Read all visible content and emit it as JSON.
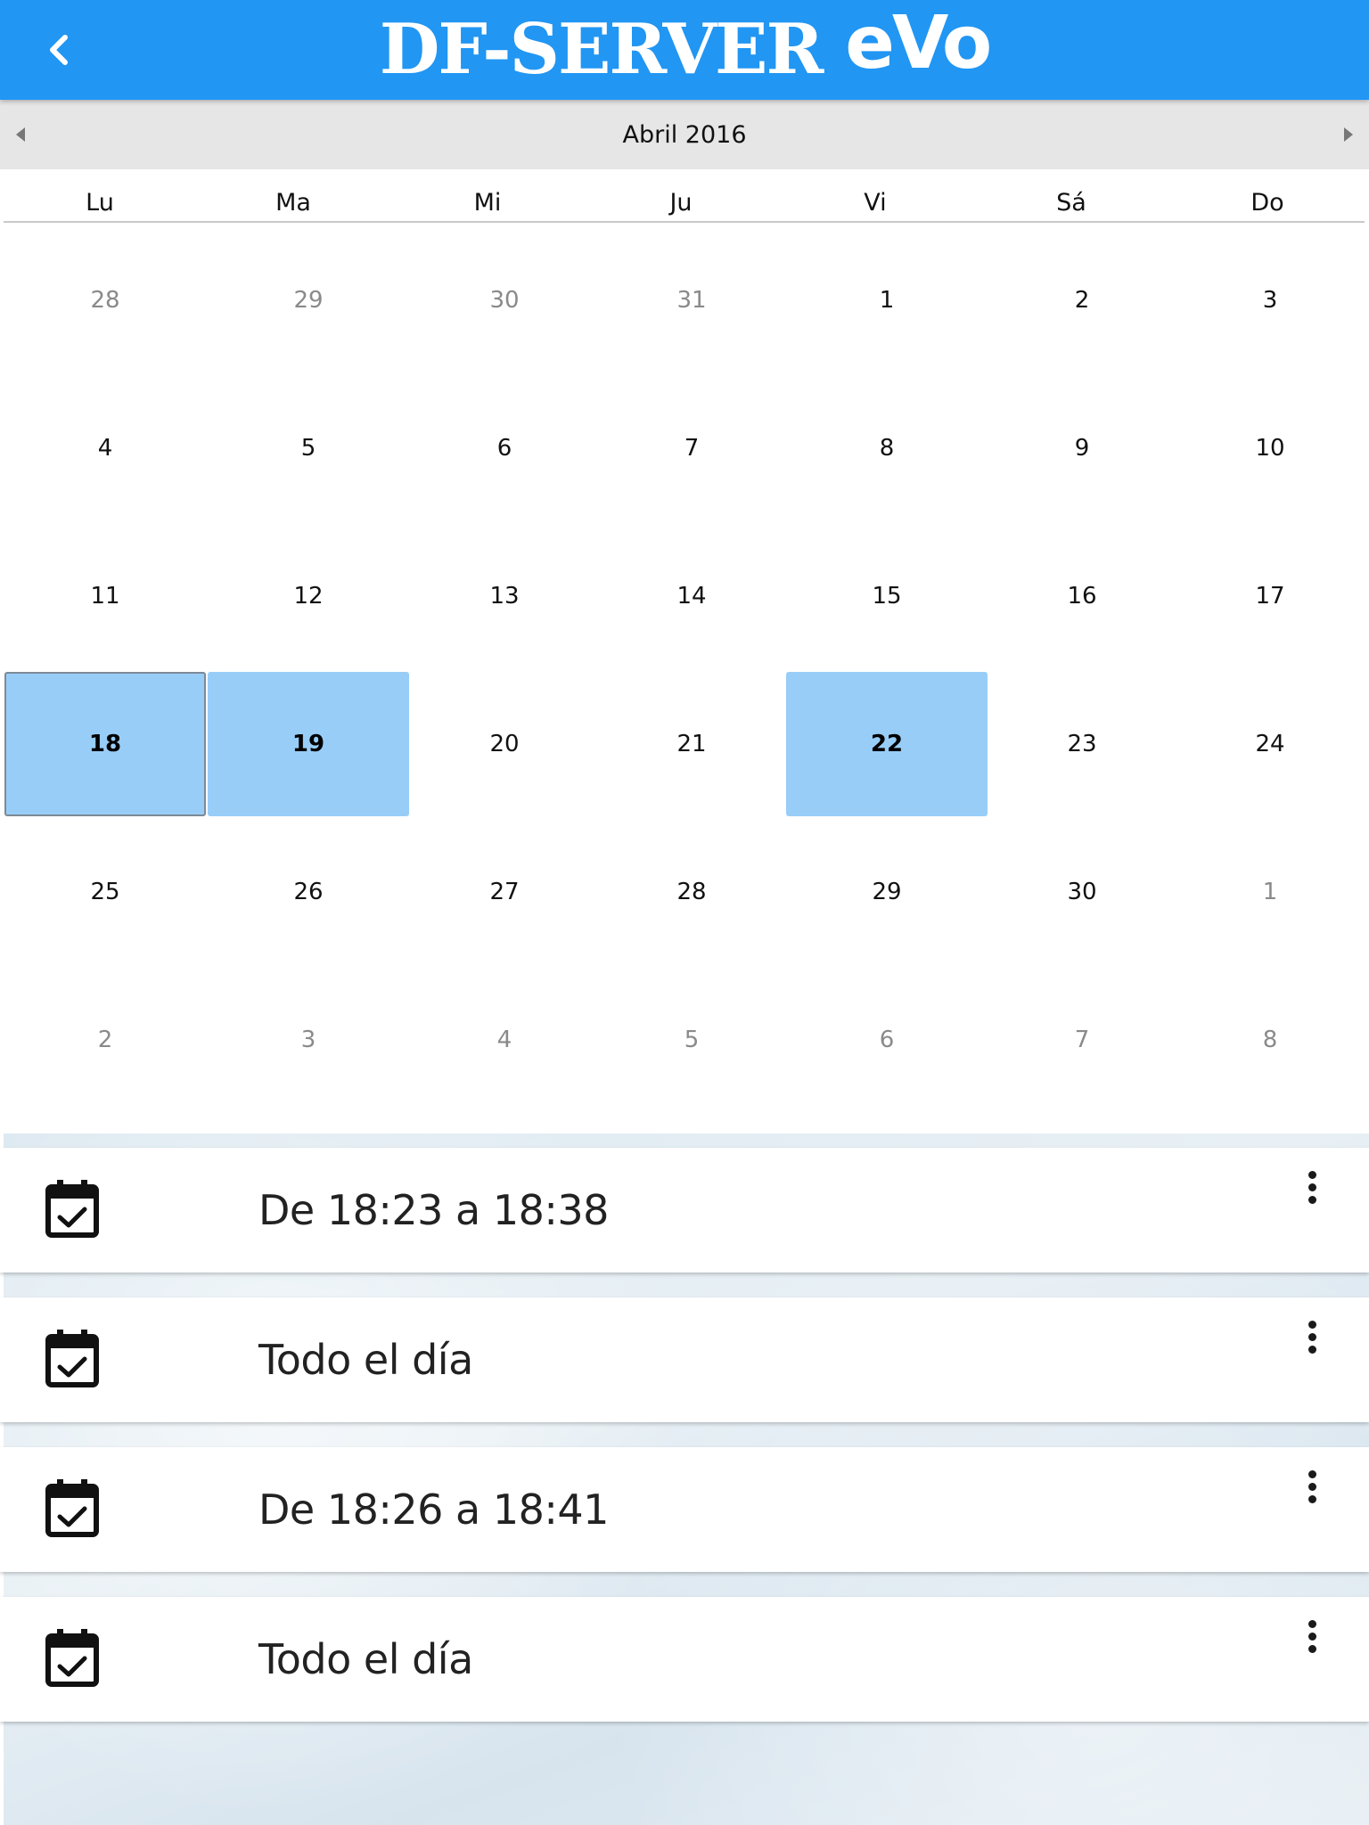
{
  "header": {
    "back_icon": "chevron-left-icon",
    "brand_main": "DF-SERVER",
    "brand_sub": "eVo",
    "color": "#2196f3"
  },
  "calendar": {
    "month_label": "Abril 2016",
    "prev_icon": "triangle-left-icon",
    "next_icon": "triangle-right-icon",
    "weekdays": [
      "Lu",
      "Ma",
      "Mi",
      "Ju",
      "Vi",
      "Sá",
      "Do"
    ],
    "weeks": [
      [
        {
          "d": "28",
          "muted": true
        },
        {
          "d": "29",
          "muted": true
        },
        {
          "d": "30",
          "muted": true
        },
        {
          "d": "31",
          "muted": true
        },
        {
          "d": "1"
        },
        {
          "d": "2"
        },
        {
          "d": "3"
        }
      ],
      [
        {
          "d": "4"
        },
        {
          "d": "5"
        },
        {
          "d": "6"
        },
        {
          "d": "7"
        },
        {
          "d": "8"
        },
        {
          "d": "9"
        },
        {
          "d": "10"
        }
      ],
      [
        {
          "d": "11"
        },
        {
          "d": "12"
        },
        {
          "d": "13"
        },
        {
          "d": "14"
        },
        {
          "d": "15"
        },
        {
          "d": "16"
        },
        {
          "d": "17"
        }
      ],
      [
        {
          "d": "18",
          "marked": true,
          "today": true
        },
        {
          "d": "19",
          "marked": true
        },
        {
          "d": "20"
        },
        {
          "d": "21"
        },
        {
          "d": "22",
          "marked": true
        },
        {
          "d": "23"
        },
        {
          "d": "24"
        }
      ],
      [
        {
          "d": "25"
        },
        {
          "d": "26"
        },
        {
          "d": "27"
        },
        {
          "d": "28"
        },
        {
          "d": "29"
        },
        {
          "d": "30"
        },
        {
          "d": "1",
          "muted": true
        }
      ],
      [
        {
          "d": "2",
          "muted": true
        },
        {
          "d": "3",
          "muted": true
        },
        {
          "d": "4",
          "muted": true
        },
        {
          "d": "5",
          "muted": true
        },
        {
          "d": "6",
          "muted": true
        },
        {
          "d": "7",
          "muted": true
        },
        {
          "d": "8",
          "muted": true
        }
      ]
    ],
    "marked_color": "#98cdf8"
  },
  "events": [
    {
      "icon": "calendar-check-icon",
      "label": "De 18:23 a 18:38",
      "menu_icon": "more-vertical-icon"
    },
    {
      "icon": "calendar-check-icon",
      "label": "Todo el día",
      "menu_icon": "more-vertical-icon"
    },
    {
      "icon": "calendar-check-icon",
      "label": "De 18:26 a 18:41",
      "menu_icon": "more-vertical-icon"
    },
    {
      "icon": "calendar-check-icon",
      "label": "Todo el día",
      "menu_icon": "more-vertical-icon"
    }
  ]
}
